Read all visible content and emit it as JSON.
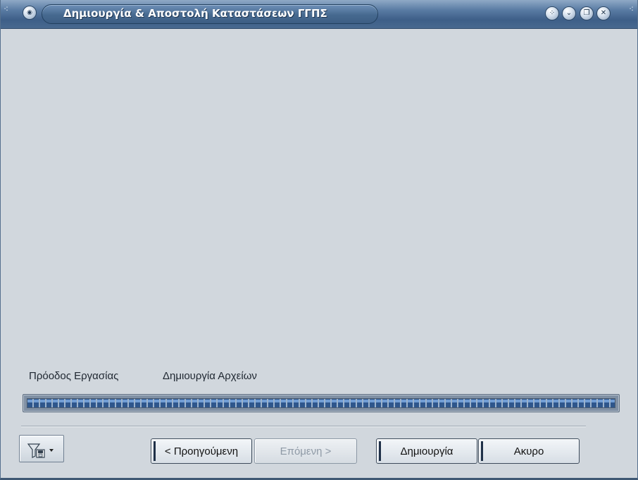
{
  "window": {
    "title": "Δημιουργία & Αποστολή Καταστάσεων ΓΓΠΣ"
  },
  "progress": {
    "label": "Πρόοδος Εργασίας",
    "status": "Δημιουργία Αρχείων",
    "fraction": 1.0
  },
  "footer": {
    "filter_icon": "filter-save-icon",
    "back_label": "< Προηγούμενη",
    "next_label": "Επόμενη >",
    "create_label": "Δημιουργία",
    "cancel_label": "Ακυρο"
  },
  "colors": {
    "titlebar": "#4a6c94",
    "progress_fill": "#2e568c",
    "background": "#d1d7dd"
  }
}
